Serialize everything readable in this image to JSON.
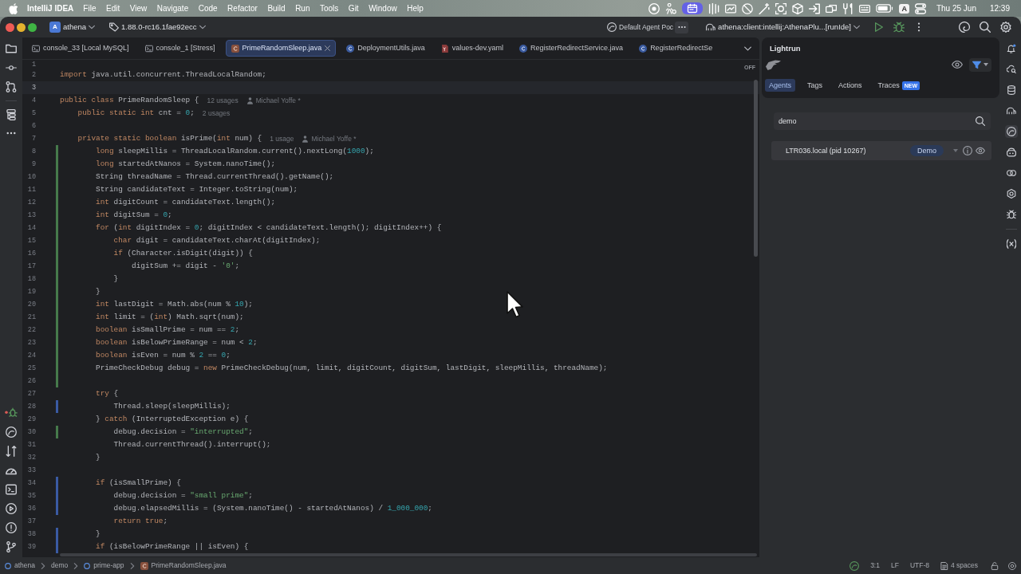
{
  "menu_bar": {
    "app_name": "IntelliJ IDEA",
    "menus": [
      "File",
      "Edit",
      "View",
      "Navigate",
      "Code",
      "Refactor",
      "Build",
      "Run",
      "Tools",
      "Git",
      "Window",
      "Help"
    ],
    "input_source": "A",
    "date": "Thu 25 Jun",
    "time": "12:39"
  },
  "title_bar": {
    "project_initial": "A",
    "project": "athena",
    "branch": "1.88.0-rc16.1fae92ecc",
    "agent_pool": "Default Agent Poc",
    "run_configuration": "athena:client:intellij:AthenaPlu...[runIde]"
  },
  "editor_tabs": [
    {
      "label": "console_33 [Local MySQL]",
      "kind": "console",
      "selected": false
    },
    {
      "label": "console_1 [Stress]",
      "kind": "console",
      "selected": false
    },
    {
      "label": "PrimeRandomSleep.java",
      "kind": "runnable_class",
      "selected": true
    },
    {
      "label": "DeploymentUtils.java",
      "kind": "class",
      "selected": false
    },
    {
      "label": "values-dev.yaml",
      "kind": "yaml",
      "selected": false
    },
    {
      "label": "RegisterRedirectService.java",
      "kind": "class",
      "selected": false
    },
    {
      "label": "RegisterRedirectSe",
      "kind": "class",
      "selected": false
    }
  ],
  "editor": {
    "inspection_widget": "OFF",
    "lines": [
      {
        "number": "1",
        "current": false,
        "added": false,
        "modified": false
      },
      {
        "number": "2",
        "current": false,
        "added": false,
        "modified": false,
        "tokens": [
          {
            "kind": "keyword",
            "text": "import"
          },
          {
            "kind": "plain",
            "text": " java.util.concurrent.ThreadLocalRandom;"
          }
        ]
      },
      {
        "number": "3",
        "current": true,
        "added": false,
        "modified": false
      },
      {
        "number": "4",
        "current": false,
        "added": false,
        "modified": false,
        "tokens": [
          {
            "kind": "keyword",
            "text": "public class"
          },
          {
            "kind": "plain",
            "text": " PrimeRandomSleep {"
          }
        ],
        "usages": "12 usages",
        "author": "Michael Yoffe *"
      },
      {
        "number": "5",
        "current": false,
        "added": false,
        "modified": false,
        "tokens": [
          {
            "kind": "keyword",
            "text": "    public static int"
          },
          {
            "kind": "plain",
            "text": " cnt = "
          },
          {
            "kind": "number",
            "text": "0"
          },
          {
            "kind": "plain",
            "text": ";"
          }
        ],
        "usages": "2 usages"
      },
      {
        "number": "6",
        "current": false,
        "added": false,
        "modified": false
      },
      {
        "number": "7",
        "current": false,
        "added": false,
        "modified": false,
        "tokens": [
          {
            "kind": "keyword",
            "text": "    private static boolean"
          },
          {
            "kind": "plain",
            "text": " isPrime("
          },
          {
            "kind": "keyword",
            "text": "int"
          },
          {
            "kind": "plain",
            "text": " num) {"
          }
        ],
        "usages": "1 usage",
        "author": "Michael Yoffe *"
      },
      {
        "number": "8",
        "current": false,
        "added": true,
        "modified": false,
        "tokens": [
          {
            "kind": "keyword",
            "text": "        long"
          },
          {
            "kind": "plain",
            "text": " sleepMillis = ThreadLocalRandom.current().nextLong("
          },
          {
            "kind": "number",
            "text": "1000"
          },
          {
            "kind": "plain",
            "text": ");"
          }
        ]
      },
      {
        "number": "9",
        "current": false,
        "added": true,
        "modified": false,
        "tokens": [
          {
            "kind": "keyword",
            "text": "        long"
          },
          {
            "kind": "plain",
            "text": " startedAtNanos = System.nanoTime();"
          }
        ]
      },
      {
        "number": "10",
        "current": false,
        "added": true,
        "modified": false,
        "tokens": [
          {
            "kind": "plain",
            "text": "        String threadName = Thread.currentThread().getName();"
          }
        ]
      },
      {
        "number": "11",
        "current": false,
        "added": true,
        "modified": false,
        "tokens": [
          {
            "kind": "plain",
            "text": "        String candidateText = Integer.toString(num);"
          }
        ]
      },
      {
        "number": "12",
        "current": false,
        "added": true,
        "modified": false,
        "tokens": [
          {
            "kind": "keyword",
            "text": "        int"
          },
          {
            "kind": "plain",
            "text": " digitCount = candidateText.length();"
          }
        ]
      },
      {
        "number": "13",
        "current": false,
        "added": true,
        "modified": false,
        "tokens": [
          {
            "kind": "keyword",
            "text": "        int"
          },
          {
            "kind": "plain",
            "text": " digitSum = "
          },
          {
            "kind": "number",
            "text": "0"
          },
          {
            "kind": "plain",
            "text": ";"
          }
        ]
      },
      {
        "number": "14",
        "current": false,
        "added": true,
        "modified": false,
        "tokens": [
          {
            "kind": "keyword",
            "text": "        for"
          },
          {
            "kind": "plain",
            "text": " ("
          },
          {
            "kind": "keyword",
            "text": "int"
          },
          {
            "kind": "plain",
            "text": " digitIndex = "
          },
          {
            "kind": "number",
            "text": "0"
          },
          {
            "kind": "plain",
            "text": "; digitIndex < candidateText.length(); digitIndex++) {"
          }
        ]
      },
      {
        "number": "15",
        "current": false,
        "added": true,
        "modified": false,
        "tokens": [
          {
            "kind": "keyword",
            "text": "            char"
          },
          {
            "kind": "plain",
            "text": " digit = candidateText.charAt(digitIndex);"
          }
        ]
      },
      {
        "number": "16",
        "current": false,
        "added": true,
        "modified": false,
        "tokens": [
          {
            "kind": "keyword",
            "text": "            if"
          },
          {
            "kind": "plain",
            "text": " (Character.isDigit(digit)) {"
          }
        ]
      },
      {
        "number": "17",
        "current": false,
        "added": true,
        "modified": false,
        "tokens": [
          {
            "kind": "plain",
            "text": "                digitSum += digit - "
          },
          {
            "kind": "string",
            "text": "'0'"
          },
          {
            "kind": "plain",
            "text": ";"
          }
        ]
      },
      {
        "number": "18",
        "current": false,
        "added": true,
        "modified": false,
        "tokens": [
          {
            "kind": "plain",
            "text": "            }"
          }
        ]
      },
      {
        "number": "19",
        "current": false,
        "added": true,
        "modified": false,
        "tokens": [
          {
            "kind": "plain",
            "text": "        }"
          }
        ]
      },
      {
        "number": "20",
        "current": false,
        "added": true,
        "modified": false,
        "tokens": [
          {
            "kind": "keyword",
            "text": "        int"
          },
          {
            "kind": "plain",
            "text": " lastDigit = Math.abs(num % "
          },
          {
            "kind": "number",
            "text": "10"
          },
          {
            "kind": "plain",
            "text": ");"
          }
        ]
      },
      {
        "number": "21",
        "current": false,
        "added": true,
        "modified": false,
        "tokens": [
          {
            "kind": "keyword",
            "text": "        int"
          },
          {
            "kind": "plain",
            "text": " limit = ("
          },
          {
            "kind": "keyword",
            "text": "int"
          },
          {
            "kind": "plain",
            "text": ") Math.sqrt(num);"
          }
        ]
      },
      {
        "number": "22",
        "current": false,
        "added": true,
        "modified": false,
        "tokens": [
          {
            "kind": "keyword",
            "text": "        boolean"
          },
          {
            "kind": "plain",
            "text": " isSmallPrime = num == "
          },
          {
            "kind": "number",
            "text": "2"
          },
          {
            "kind": "plain",
            "text": ";"
          }
        ]
      },
      {
        "number": "23",
        "current": false,
        "added": true,
        "modified": false,
        "tokens": [
          {
            "kind": "keyword",
            "text": "        boolean"
          },
          {
            "kind": "plain",
            "text": " isBelowPrimeRange = num < "
          },
          {
            "kind": "number",
            "text": "2"
          },
          {
            "kind": "plain",
            "text": ";"
          }
        ]
      },
      {
        "number": "24",
        "current": false,
        "added": true,
        "modified": false,
        "tokens": [
          {
            "kind": "keyword",
            "text": "        boolean"
          },
          {
            "kind": "plain",
            "text": " isEven = num % "
          },
          {
            "kind": "number",
            "text": "2"
          },
          {
            "kind": "plain",
            "text": " == "
          },
          {
            "kind": "number",
            "text": "0"
          },
          {
            "kind": "plain",
            "text": ";"
          }
        ]
      },
      {
        "number": "25",
        "current": false,
        "added": true,
        "modified": false,
        "tokens": [
          {
            "kind": "plain",
            "text": "        PrimeCheckDebug debug = "
          },
          {
            "kind": "keyword",
            "text": "new"
          },
          {
            "kind": "plain",
            "text": " PrimeCheckDebug(num, limit, digitCount, digitSum, lastDigit, sleepMillis, threadName);"
          }
        ]
      },
      {
        "number": "26",
        "current": false,
        "added": true,
        "modified": false
      },
      {
        "number": "27",
        "current": false,
        "added": false,
        "modified": false,
        "tokens": [
          {
            "kind": "keyword",
            "text": "        try"
          },
          {
            "kind": "plain",
            "text": " {"
          }
        ]
      },
      {
        "number": "28",
        "current": false,
        "added": false,
        "modified": true,
        "tokens": [
          {
            "kind": "plain",
            "text": "            Thread.sleep(sleepMillis);"
          }
        ]
      },
      {
        "number": "29",
        "current": false,
        "added": false,
        "modified": false,
        "tokens": [
          {
            "kind": "plain",
            "text": "        } "
          },
          {
            "kind": "keyword",
            "text": "catch"
          },
          {
            "kind": "plain",
            "text": " (InterruptedException e) {"
          }
        ]
      },
      {
        "number": "30",
        "current": false,
        "added": true,
        "modified": false,
        "tokens": [
          {
            "kind": "plain",
            "text": "            debug.decision = "
          },
          {
            "kind": "string",
            "text": "\"interrupted\""
          },
          {
            "kind": "plain",
            "text": ";"
          }
        ]
      },
      {
        "number": "31",
        "current": false,
        "added": false,
        "modified": false,
        "tokens": [
          {
            "kind": "plain",
            "text": "            Thread.currentThread().interrupt();"
          }
        ]
      },
      {
        "number": "32",
        "current": false,
        "added": false,
        "modified": false,
        "tokens": [
          {
            "kind": "plain",
            "text": "        }"
          }
        ]
      },
      {
        "number": "33",
        "current": false,
        "added": false,
        "modified": false
      },
      {
        "number": "34",
        "current": false,
        "added": false,
        "modified": true,
        "tokens": [
          {
            "kind": "keyword",
            "text": "        if"
          },
          {
            "kind": "plain",
            "text": " (isSmallPrime) {"
          }
        ]
      },
      {
        "number": "35",
        "current": false,
        "added": false,
        "modified": true,
        "tokens": [
          {
            "kind": "plain",
            "text": "            debug.decision = "
          },
          {
            "kind": "string",
            "text": "\"small prime\""
          },
          {
            "kind": "plain",
            "text": ";"
          }
        ]
      },
      {
        "number": "36",
        "current": false,
        "added": false,
        "modified": true,
        "tokens": [
          {
            "kind": "plain",
            "text": "            debug.elapsedMillis = (System.nanoTime() - startedAtNanos) / "
          },
          {
            "kind": "number",
            "text": "1_000_000"
          },
          {
            "kind": "plain",
            "text": ";"
          }
        ]
      },
      {
        "number": "37",
        "current": false,
        "added": false,
        "modified": false,
        "tokens": [
          {
            "kind": "keyword",
            "text": "            return true"
          },
          {
            "kind": "plain",
            "text": ";"
          }
        ]
      },
      {
        "number": "38",
        "current": false,
        "added": false,
        "modified": true,
        "tokens": [
          {
            "kind": "plain",
            "text": "        }"
          }
        ]
      },
      {
        "number": "39",
        "current": false,
        "added": false,
        "modified": true,
        "tokens": [
          {
            "kind": "keyword",
            "text": "        if"
          },
          {
            "kind": "plain",
            "text": " (isBelowPrimeRange || isEven) {"
          }
        ]
      }
    ]
  },
  "lightrun": {
    "title": "Lightrun",
    "tabs": [
      {
        "label": "Agents",
        "selected": true
      },
      {
        "label": "Tags",
        "selected": false
      },
      {
        "label": "Actions",
        "selected": false
      },
      {
        "label": "Traces",
        "selected": false,
        "badge": "NEW"
      }
    ],
    "search": {
      "value": "demo"
    },
    "agents": [
      {
        "name": "LTR036.local (pid 10267)",
        "tag": "Demo"
      }
    ]
  },
  "right_tool_windows": [
    {
      "selected": false
    },
    {
      "selected": false
    },
    {
      "selected": false
    },
    {
      "selected": false
    },
    {
      "selected": true
    },
    {
      "selected": false
    },
    {
      "selected": false
    },
    {
      "selected": false
    },
    {
      "selected": false
    },
    {
      "selected": false
    }
  ],
  "status_bar": {
    "breadcrumbs": [
      {
        "label": "athena",
        "kind": "module"
      },
      {
        "label": "demo",
        "kind": "directory"
      },
      {
        "label": "prime-app",
        "kind": "module"
      },
      {
        "label": "PrimeRandomSleep.java",
        "kind": "runnable_class"
      }
    ],
    "caret_position": "3:1",
    "line_separator": "LF",
    "encoding": "UTF-8",
    "indentation": "4 spaces"
  }
}
